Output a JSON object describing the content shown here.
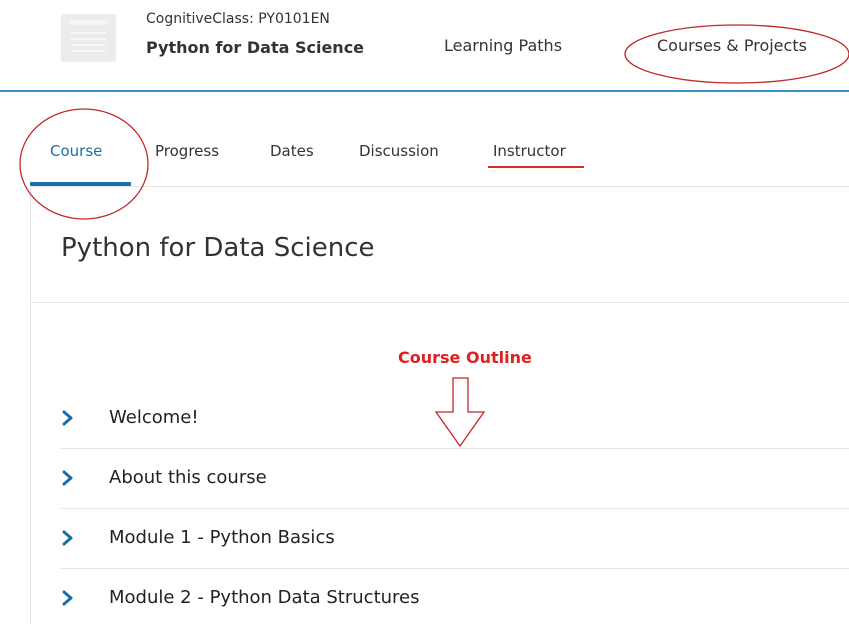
{
  "header": {
    "course_code": "CognitiveClass: PY0101EN",
    "course_title": "Python for Data Science",
    "nav": [
      {
        "label": "Learning Paths"
      },
      {
        "label": "Courses & Projects"
      }
    ]
  },
  "tabs": [
    {
      "label": "Course",
      "active": true
    },
    {
      "label": "Progress"
    },
    {
      "label": "Dates"
    },
    {
      "label": "Discussion"
    },
    {
      "label": "Instructor"
    }
  ],
  "main": {
    "page_title": "Python for Data Science",
    "annotation_label": "Course Outline",
    "outline": [
      {
        "label": "Welcome!",
        "icon": "chevron-right-icon"
      },
      {
        "label": "About this course",
        "icon": "chevron-right-icon"
      },
      {
        "label": "Module 1 - Python Basics",
        "icon": "chevron-right-icon"
      },
      {
        "label": "Module 2 - Python Data Structures",
        "icon": "chevron-right-icon"
      }
    ]
  },
  "colors": {
    "accent_blue": "#1a6fa8",
    "header_rule": "#3a8fc9",
    "annotation_red": "#e02020"
  }
}
